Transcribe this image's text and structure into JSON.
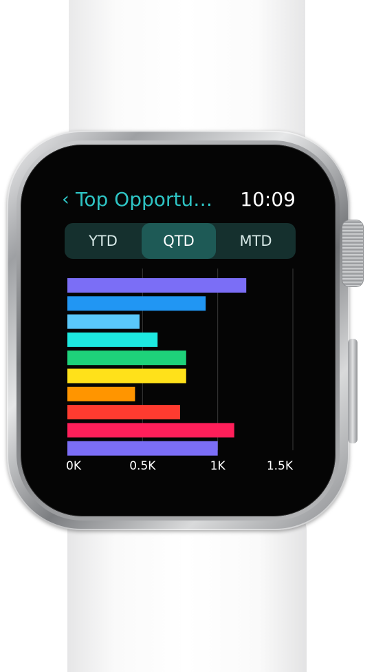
{
  "app": {
    "title": "Top Opportu…",
    "back_icon": "chevron-left-icon",
    "time": "10:09"
  },
  "colors": {
    "accent": "#2ec4c4",
    "segment_bg": "#15302e",
    "segment_selected": "#1e5a56"
  },
  "segments": {
    "items": [
      "YTD",
      "QTD",
      "MTD"
    ],
    "selected": "QTD"
  },
  "chart_data": {
    "type": "bar",
    "orientation": "horizontal",
    "xlim": [
      0,
      1500
    ],
    "xticks": [
      "0K",
      "0.5K",
      "1K",
      "1.5K"
    ],
    "tick_values": [
      0,
      500,
      1000,
      1500
    ],
    "grid": true,
    "values": [
      1190,
      920,
      480,
      600,
      790,
      790,
      450,
      750,
      1110,
      1000
    ],
    "colors": [
      "#7b6ef6",
      "#2196f3",
      "#5ac8fa",
      "#1de9e0",
      "#1ed27a",
      "#ffe11a",
      "#ff9500",
      "#ff3b30",
      "#ff1f5a",
      "#7b6ef6"
    ]
  }
}
